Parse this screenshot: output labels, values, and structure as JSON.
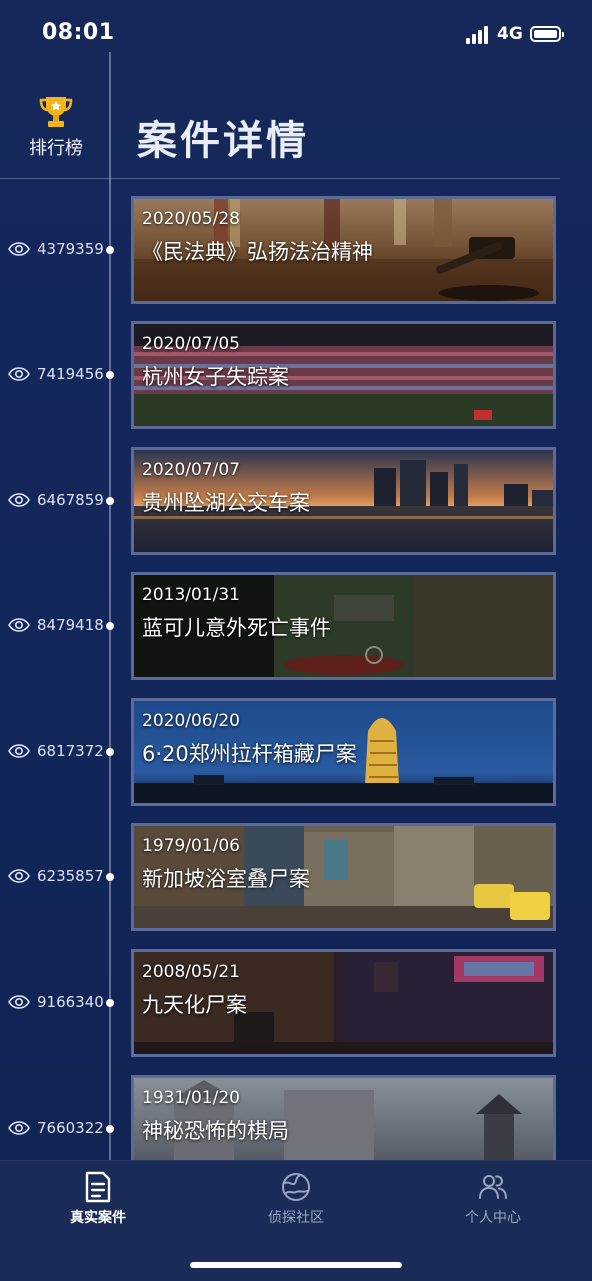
{
  "status_bar": {
    "time": "08:01",
    "network": "4G"
  },
  "header": {
    "ranking_label": "排行榜",
    "title": "案件详情"
  },
  "cases": [
    {
      "date": "2020/05/28",
      "title": "《民法典》弘扬法治精神",
      "views": "4379359"
    },
    {
      "date": "2020/07/05",
      "title": "杭州女子失踪案",
      "views": "7419456"
    },
    {
      "date": "2020/07/07",
      "title": "贵州坠湖公交车案",
      "views": "6467859"
    },
    {
      "date": "2013/01/31",
      "title": "蓝可儿意外死亡事件",
      "views": "8479418"
    },
    {
      "date": "2020/06/20",
      "title": "6·20郑州拉杆箱藏尸案",
      "views": "6817372"
    },
    {
      "date": "1979/01/06",
      "title": "新加坡浴室叠尸案",
      "views": "6235857"
    },
    {
      "date": "2008/05/21",
      "title": "九天化尸案",
      "views": "9166340"
    },
    {
      "date": "1931/01/20",
      "title": "神秘恐怖的棋局",
      "views": "7660322"
    }
  ],
  "bottom_nav": [
    {
      "label": "真实案件",
      "icon": "document-icon",
      "active": true
    },
    {
      "label": "侦探社区",
      "icon": "globe-icon",
      "active": false
    },
    {
      "label": "个人中心",
      "icon": "users-icon",
      "active": false
    }
  ],
  "colors": {
    "background": "#13265a",
    "card_border": "#5b6a99",
    "nav_background": "#1a2b58",
    "trophy": "#f2b41c"
  }
}
